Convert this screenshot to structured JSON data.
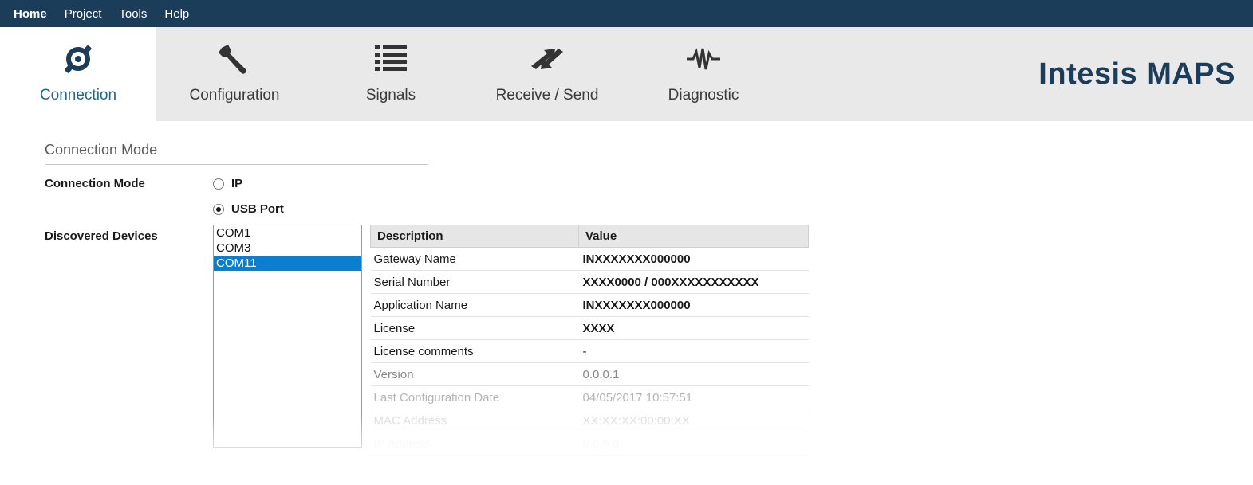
{
  "menu": {
    "items": [
      {
        "label": "Home",
        "active": true
      },
      {
        "label": "Project"
      },
      {
        "label": "Tools"
      },
      {
        "label": "Help"
      }
    ]
  },
  "ribbon": {
    "tabs": [
      {
        "label": "Connection",
        "icon": "connection-icon",
        "active": true
      },
      {
        "label": "Configuration",
        "icon": "wrench-icon"
      },
      {
        "label": "Signals",
        "icon": "list-icon"
      },
      {
        "label": "Receive / Send",
        "icon": "transfer-arrows-icon"
      },
      {
        "label": "Diagnostic",
        "icon": "waveform-icon"
      }
    ],
    "brand": "Intesis MAPS"
  },
  "connection": {
    "section_title": "Connection Mode",
    "mode_label": "Connection Mode",
    "options": [
      {
        "label": "IP",
        "selected": false
      },
      {
        "label": "USB Port",
        "selected": true
      }
    ],
    "devices_label": "Discovered Devices",
    "devices": [
      "COM1",
      "COM3",
      "COM11"
    ],
    "selected_device": "COM11"
  },
  "details": {
    "headers": [
      "Description",
      "Value"
    ],
    "rows": [
      {
        "desc": "Gateway Name",
        "value": "INXXXXXXX000000"
      },
      {
        "desc": "Serial Number",
        "value": "XXXX0000 / 000XXXXXXXXXXX"
      },
      {
        "desc": "Application Name",
        "value": "INXXXXXXX000000"
      },
      {
        "desc": "License",
        "value": "XXXX"
      },
      {
        "desc": "License comments",
        "value": "-"
      },
      {
        "desc": "Version",
        "value": "0.0.0.1"
      },
      {
        "desc": "Last Configuration Date",
        "value": "04/05/2017 10:57:51"
      },
      {
        "desc": "MAC Address",
        "value": "XX:XX:XX:00:00:XX"
      },
      {
        "desc": "IP Address",
        "value": "0.0.0.0"
      }
    ]
  },
  "colors": {
    "menubar": "#1c3d5a",
    "ribbon": "#e9e9ea",
    "accent": "#1a6a8c",
    "selection": "#0a7fd0"
  }
}
